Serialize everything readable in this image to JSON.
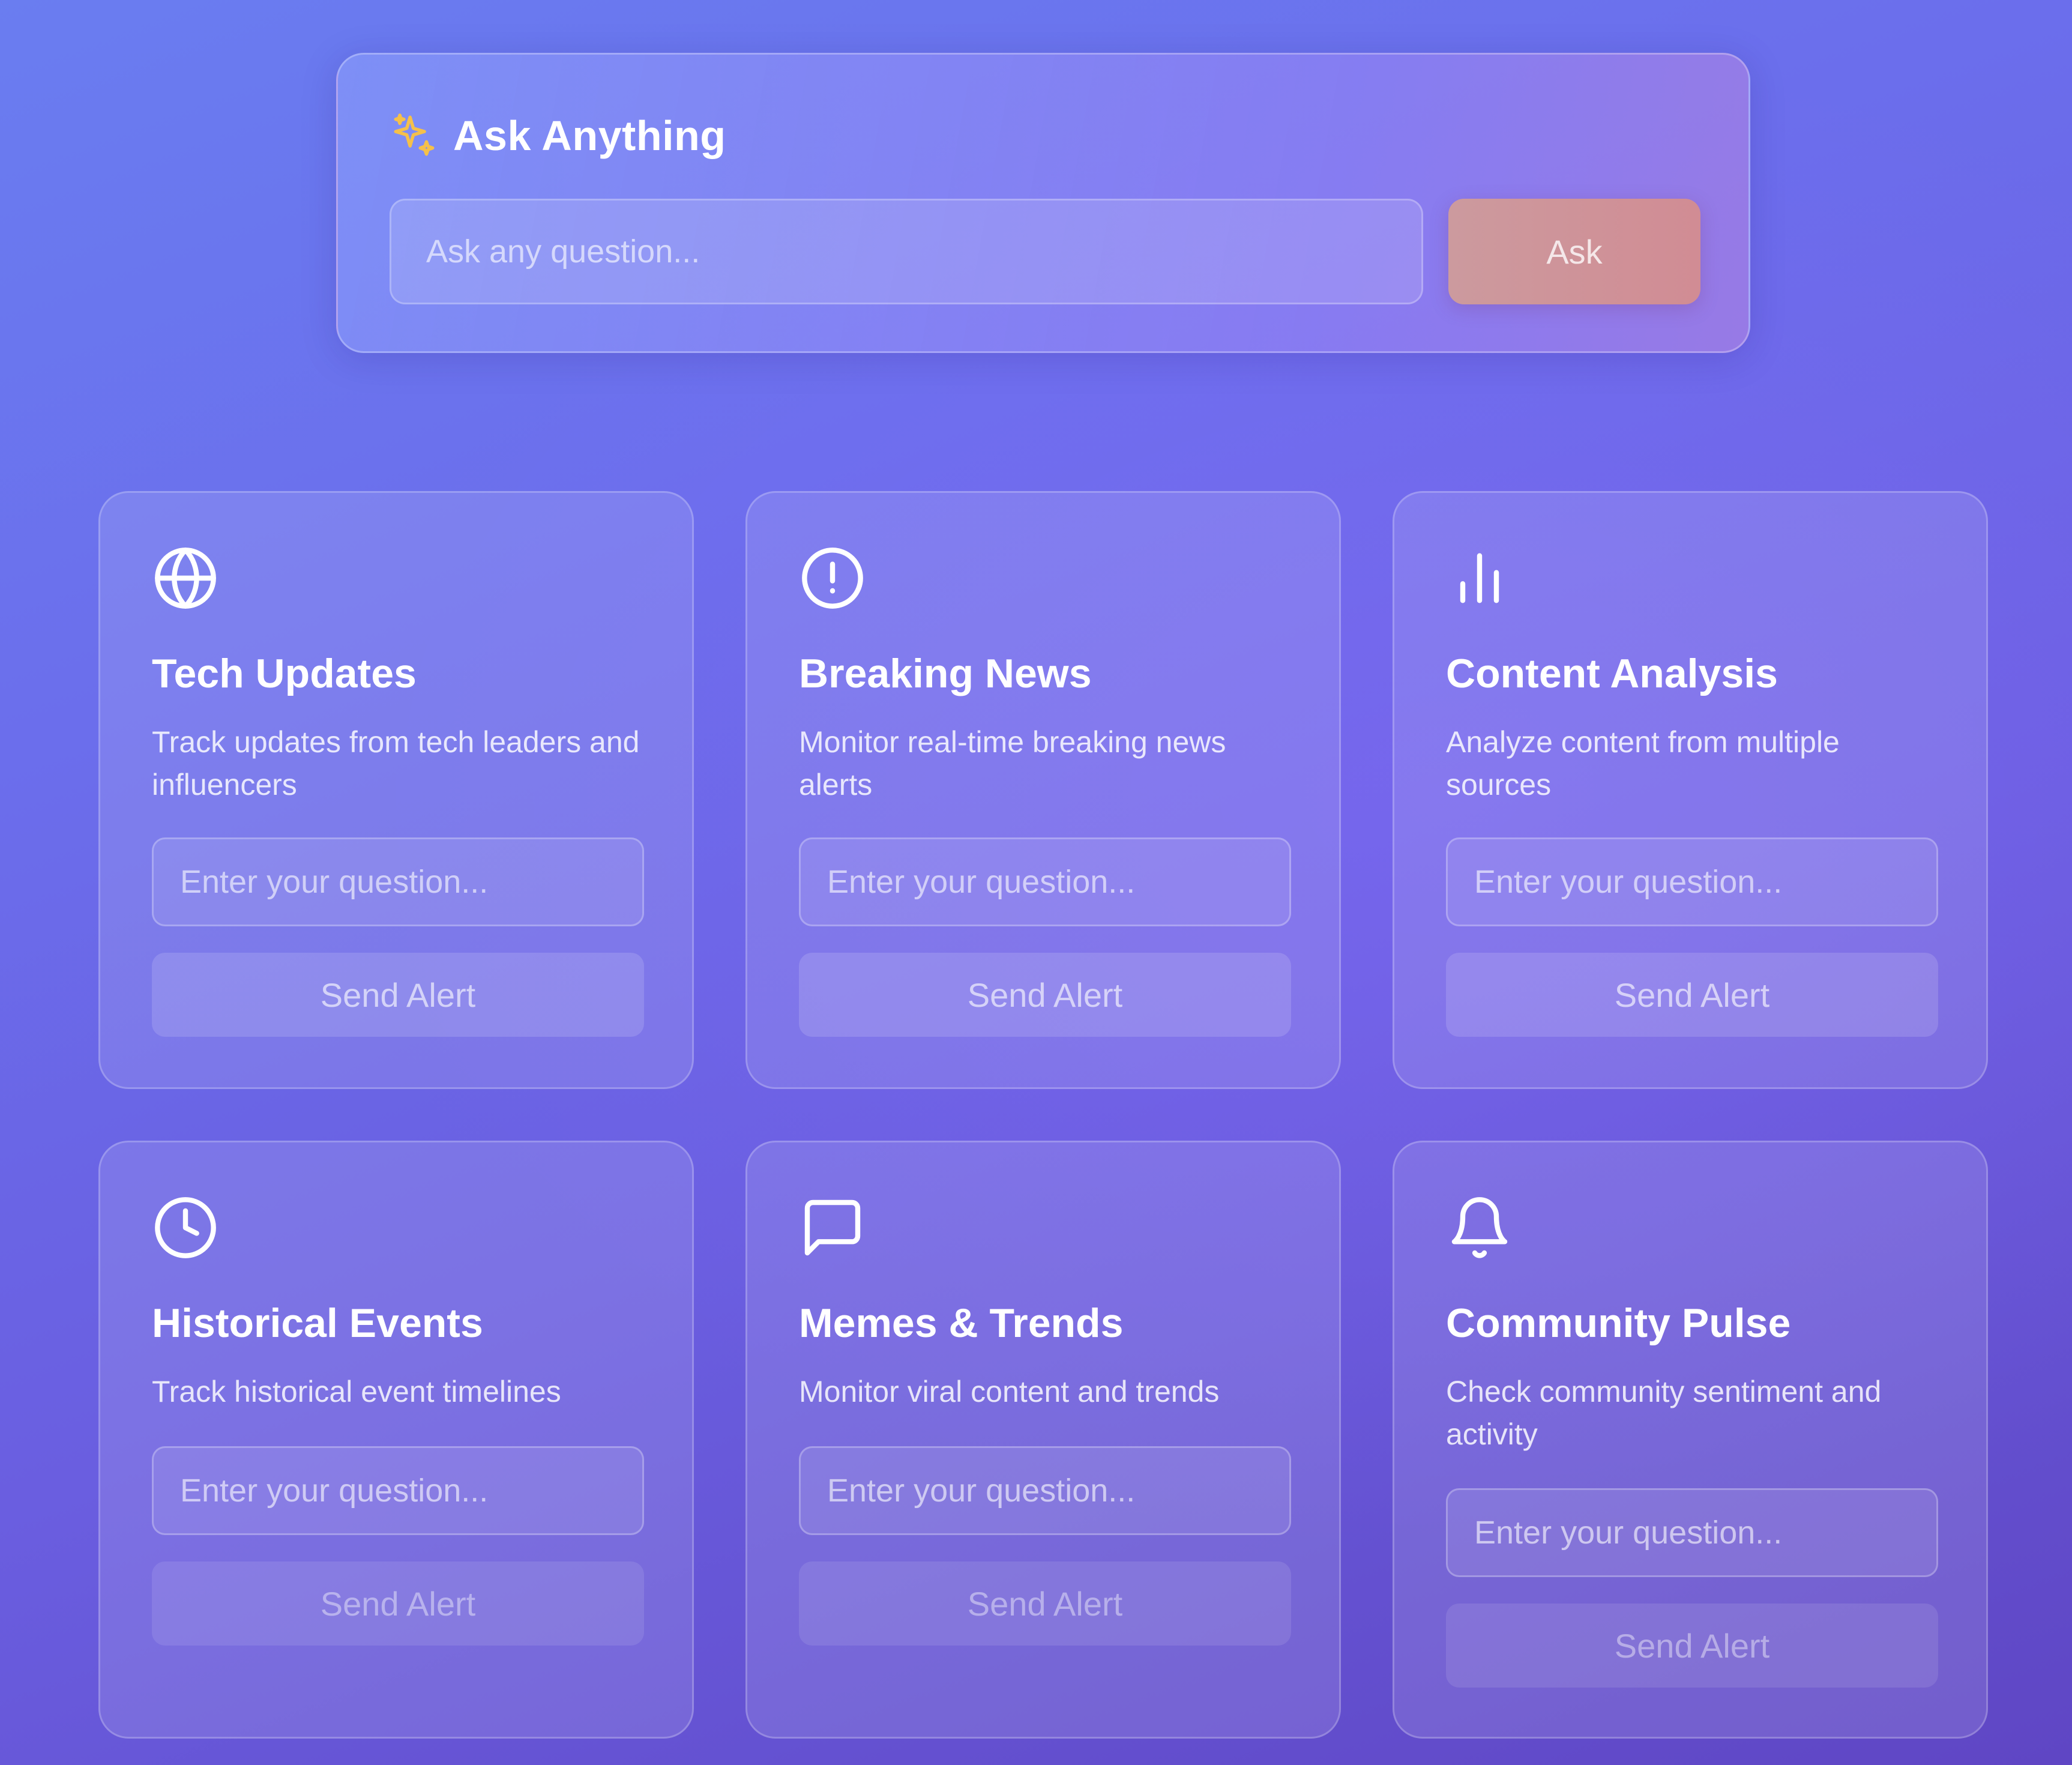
{
  "ask": {
    "title": "Ask Anything",
    "icon": "sparkle-icon",
    "placeholder": "Ask any question...",
    "button_label": "Ask"
  },
  "cards": [
    {
      "icon": "globe-icon",
      "title": "Tech Updates",
      "description": "Track updates from tech leaders and influencers",
      "placeholder": "Enter your question...",
      "button_label": "Send Alert"
    },
    {
      "icon": "alert-circle-icon",
      "title": "Breaking News",
      "description": "Monitor real-time breaking news alerts",
      "placeholder": "Enter your question...",
      "button_label": "Send Alert"
    },
    {
      "icon": "bar-chart-icon",
      "title": "Content Analysis",
      "description": "Analyze content from multiple sources",
      "placeholder": "Enter your question...",
      "button_label": "Send Alert"
    },
    {
      "icon": "clock-icon",
      "title": "Historical Events",
      "description": "Track historical event timelines",
      "placeholder": "Enter your question...",
      "button_label": "Send Alert"
    },
    {
      "icon": "message-square-icon",
      "title": "Memes & Trends",
      "description": "Monitor viral content and trends",
      "placeholder": "Enter your question...",
      "button_label": "Send Alert"
    },
    {
      "icon": "bell-icon",
      "title": "Community Pulse",
      "description": "Check community sentiment and activity",
      "placeholder": "Enter your question...",
      "button_label": "Send Alert"
    }
  ],
  "colors": {
    "background_top": "#6a7df0",
    "background_bottom": "#5f46c4",
    "ask_button": "#d18c94",
    "sparkle": "#f5c04a"
  }
}
